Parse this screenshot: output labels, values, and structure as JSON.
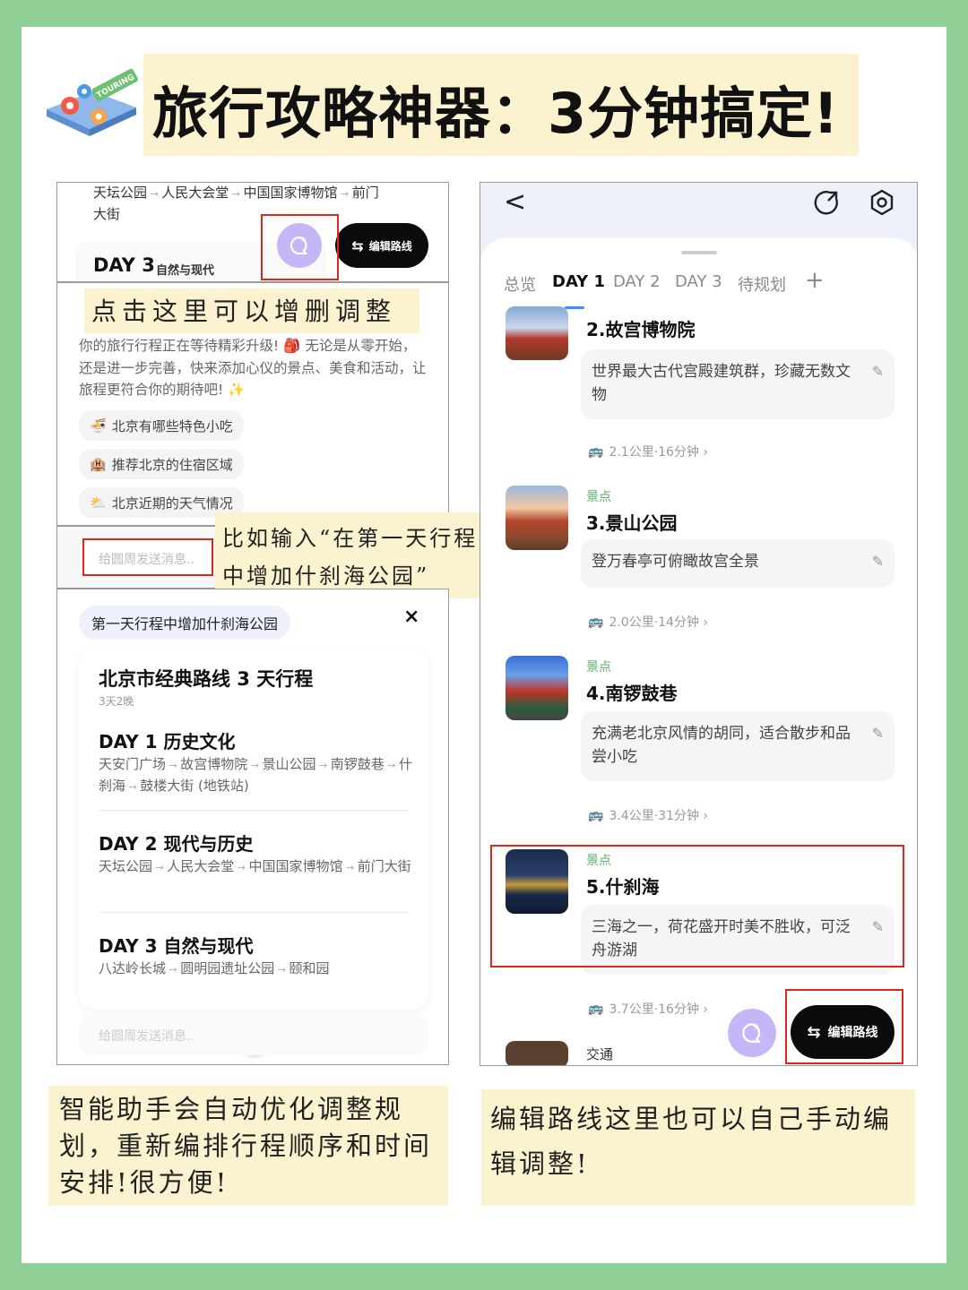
{
  "header": {
    "title": "旅行攻略神器：3分钟搞定!",
    "icon_badge": "TOURING"
  },
  "left_panel": {
    "top_route": "天坛公园 → 人民大会堂 → 中国国家博物馆 → 前门大街",
    "top_route_parts": [
      "天坛公园",
      "人民大会堂",
      "中国国家博物馆",
      "前门大街"
    ],
    "day3_label": "DAY 3",
    "day3_sub": "自然与现代",
    "edit_route_label": "编辑路线",
    "callout_click": "点击这里可以增删调整",
    "close_glyph": "×",
    "assistant_message": "你的旅行行程正在等待精彩升级! 🎒 无论是从零开始，还是进一步完善，快来添加心仪的景点、美食和活动，让旅程更符合你的期待吧! ✨",
    "suggestions": [
      {
        "icon": "noodle-bowl-icon",
        "label": "北京有哪些特色小吃"
      },
      {
        "icon": "hotel-icon",
        "label": "推荐北京的住宿区域"
      },
      {
        "icon": "weather-icon",
        "label": "北京近期的天气情况"
      }
    ],
    "input_placeholder": "给圆周发送消息..",
    "callout_input": "比如输入“在第一天行程中增加什刹海公园”",
    "user_message": "第一天行程中增加什刹海公园",
    "plan": {
      "title": "北京市经典路线 3 天行程",
      "subtitle": "3天2晚",
      "days": [
        {
          "label": "DAY 1 历史文化",
          "stops": [
            "天安门广场",
            "故宫博物院",
            "景山公园",
            "南锣鼓巷",
            "什刹海",
            "鼓楼大街 (地铁站)"
          ]
        },
        {
          "label": "DAY 2 现代与历史",
          "stops": [
            "天坛公园",
            "人民大会堂",
            "中国国家博物馆",
            "前门大街"
          ]
        },
        {
          "label": "DAY 3 自然与现代",
          "stops": [
            "八达岭长城",
            "圆明园遗址公园",
            "颐和园"
          ]
        }
      ]
    },
    "bottom_placeholder": "给圆周发送消息..",
    "scroll_down_glyph": "↓"
  },
  "right_panel": {
    "back_glyph": "<",
    "tabs": [
      "总览",
      "DAY 1",
      "DAY 2",
      "DAY 3",
      "待规划",
      "+"
    ],
    "active_tab": "DAY 1",
    "pois": [
      {
        "tag": "",
        "name": "2.故宫博物院",
        "desc": "世界最大古代宫殿建筑群，珍藏无数文物",
        "dist": "2.1公里·16分钟 ›"
      },
      {
        "tag": "景点",
        "name": "3.景山公园",
        "desc": "登万春亭可俯瞰故宫全景",
        "dist": "2.0公里·14分钟 ›"
      },
      {
        "tag": "景点",
        "name": "4.南锣鼓巷",
        "desc": "充满老北京风情的胡同，适合散步和品尝小吃",
        "dist": "3.4公里·31分钟 ›"
      },
      {
        "tag": "景点",
        "name": "5.什刹海",
        "desc": "三海之一，荷花盛开时美不胜收，可泛舟游湖",
        "dist": "3.7公里·16分钟 ›"
      }
    ],
    "next_label": "交通",
    "edit_route_label": "编辑路线",
    "pencil_glyph": "✎"
  },
  "notes": {
    "left": "智能助手会自动优化调整规划，重新编排行程顺序和时间安排!很方便!",
    "right": "编辑路线这里也可以自己手动编辑调整!"
  },
  "colors": {
    "background": "#8fcf95",
    "note": "#fbf3cf",
    "highlight": "#e0251b",
    "assistant": "#c7b6f7",
    "tag": "#5db06a",
    "tab_indicator": "#3b8cff"
  }
}
